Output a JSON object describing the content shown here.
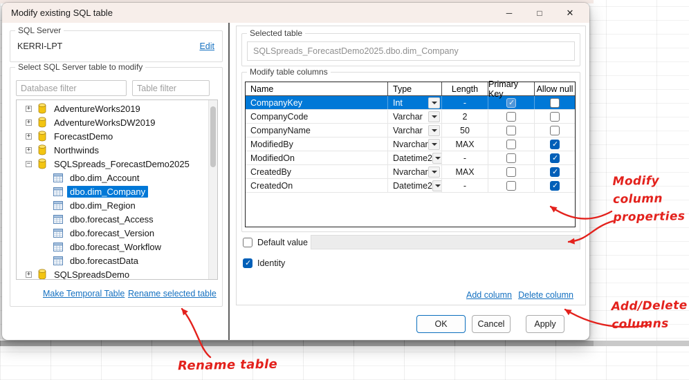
{
  "window": {
    "title": "Modify existing SQL table",
    "controls": {
      "minimize": "─",
      "maximize": "□",
      "close": "✕"
    }
  },
  "left": {
    "server_group": {
      "label": "SQL Server",
      "server_name": "KERRI-LPT",
      "edit_link": "Edit"
    },
    "table_group": {
      "label": "Select SQL Server table to modify",
      "database_filter_placeholder": "Database filter",
      "table_filter_placeholder": "Table filter",
      "tree": [
        {
          "label": "AdventureWorks2019",
          "icon": "database",
          "expander": "+",
          "level": 0,
          "selected": false
        },
        {
          "label": "AdventureWorksDW2019",
          "icon": "database",
          "expander": "+",
          "level": 0,
          "selected": false
        },
        {
          "label": "ForecastDemo",
          "icon": "database",
          "expander": "+",
          "level": 0,
          "selected": false
        },
        {
          "label": "Northwinds",
          "icon": "database",
          "expander": "+",
          "level": 0,
          "selected": false
        },
        {
          "label": "SQLSpreads_ForecastDemo2025",
          "icon": "database",
          "expander": "-",
          "level": 0,
          "selected": false
        },
        {
          "label": "dbo.dim_Account",
          "icon": "table",
          "expander": null,
          "level": 1,
          "selected": false
        },
        {
          "label": "dbo.dim_Company",
          "icon": "table",
          "expander": null,
          "level": 1,
          "selected": true
        },
        {
          "label": "dbo.dim_Region",
          "icon": "table",
          "expander": null,
          "level": 1,
          "selected": false
        },
        {
          "label": "dbo.forecast_Access",
          "icon": "table",
          "expander": null,
          "level": 1,
          "selected": false
        },
        {
          "label": "dbo.forecast_Version",
          "icon": "table",
          "expander": null,
          "level": 1,
          "selected": false
        },
        {
          "label": "dbo.forecast_Workflow",
          "icon": "table",
          "expander": null,
          "level": 1,
          "selected": false
        },
        {
          "label": "dbo.forecastData",
          "icon": "table",
          "expander": null,
          "level": 1,
          "selected": false
        },
        {
          "label": "SQLSpreadsDemo",
          "icon": "database",
          "expander": "+",
          "level": 0,
          "selected": false
        }
      ],
      "links": [
        "Make Temporal Table",
        "Rename selected table"
      ]
    }
  },
  "right": {
    "selected_table_group": {
      "label": "Selected table",
      "value": "SQLSpreads_ForecastDemo2025.dbo.dim_Company"
    },
    "columns_group": {
      "label": "Modify table columns",
      "headers": [
        "Name",
        "Type",
        "Length",
        "Primary Key",
        "Allow null"
      ],
      "rows": [
        {
          "name": "CompanyKey",
          "type": "Int",
          "length": "-",
          "primary_key": true,
          "allow_null": false,
          "selected": true
        },
        {
          "name": "CompanyCode",
          "type": "Varchar",
          "length": "2",
          "primary_key": false,
          "allow_null": false,
          "selected": false
        },
        {
          "name": "CompanyName",
          "type": "Varchar",
          "length": "50",
          "primary_key": false,
          "allow_null": false,
          "selected": false
        },
        {
          "name": "ModifiedBy",
          "type": "Nvarchar",
          "length": "MAX",
          "primary_key": false,
          "allow_null": true,
          "selected": false
        },
        {
          "name": "ModifiedOn",
          "type": "Datetime2",
          "length": "-",
          "primary_key": false,
          "allow_null": true,
          "selected": false
        },
        {
          "name": "CreatedBy",
          "type": "Nvarchar",
          "length": "MAX",
          "primary_key": false,
          "allow_null": true,
          "selected": false
        },
        {
          "name": "CreatedOn",
          "type": "Datetime2",
          "length": "-",
          "primary_key": false,
          "allow_null": true,
          "selected": false
        }
      ]
    },
    "default_value": {
      "label": "Default value",
      "checked": false,
      "field_value": ""
    },
    "identity": {
      "label": "Identity",
      "checked": true
    },
    "links": {
      "add": "Add column",
      "delete": "Delete column"
    },
    "buttons": {
      "ok": "OK",
      "cancel": "Cancel",
      "apply": "Apply"
    }
  },
  "annotations": {
    "modify_lines": [
      "Modify",
      "column",
      "properties"
    ],
    "add_delete_lines": [
      "Add/Delete",
      "columns"
    ],
    "rename": "Rename table"
  },
  "colors": {
    "selection_blue": "#0078d7",
    "checkbox_blue": "#005fb8",
    "link_blue": "#1470c0",
    "annotation_red": "#e3211c",
    "titlebar": "#f7eeea"
  }
}
